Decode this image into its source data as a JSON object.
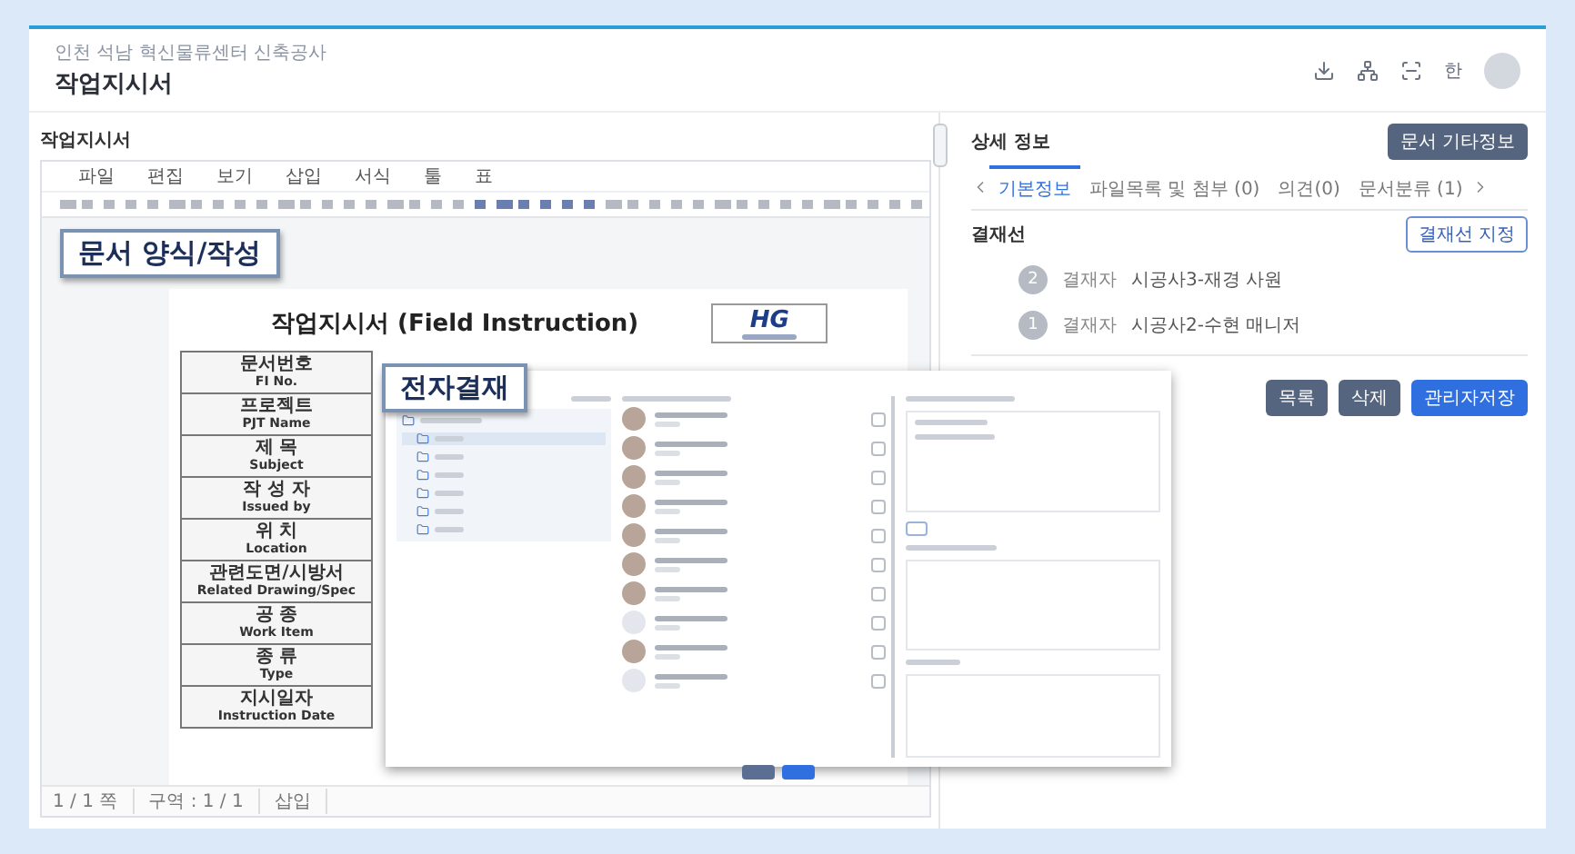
{
  "header": {
    "breadcrumb": "인천 석남 혁신물류센터 신축공사",
    "title": "작업지시서",
    "user_initial": "한"
  },
  "editor": {
    "label": "작업지시서",
    "menu": [
      "파일",
      "편집",
      "보기",
      "삽입",
      "서식",
      "툴",
      "표"
    ],
    "callout": "문서 양식/작성",
    "document": {
      "title": "작업지시서 (Field Instruction)",
      "logo": "HG",
      "fields": [
        {
          "ko": "문서번호",
          "en": "FI No."
        },
        {
          "ko": "프로젝트",
          "en": "PJT Name"
        },
        {
          "ko": "제 목",
          "en": "Subject"
        },
        {
          "ko": "작 성 자",
          "en": "Issued by"
        },
        {
          "ko": "위 치",
          "en": "Location"
        },
        {
          "ko": "관련도면/시방서",
          "en": "Related Drawing/Spec"
        },
        {
          "ko": "공 종",
          "en": "Work Item"
        },
        {
          "ko": "종 류",
          "en": "Type"
        },
        {
          "ko": "지시일자",
          "en": "Instruction Date"
        }
      ]
    },
    "status": [
      "1 / 1 쪽",
      "구역 : 1 / 1",
      "삽입"
    ]
  },
  "detail": {
    "title": "상세 정보",
    "extra_button": "문서 기타정보",
    "tabs": [
      {
        "label": "기본정보",
        "selected": true
      },
      {
        "label": "파일목록 및 첨부 (0)",
        "selected": false
      },
      {
        "label": "의견(0)",
        "selected": false
      },
      {
        "label": "문서분류 (1)",
        "selected": false
      }
    ],
    "approval": {
      "title": "결재선",
      "assign_button": "결재선 지정",
      "steps": [
        {
          "number": "2",
          "role": "결재자",
          "name": "시공사3-재경 사원"
        },
        {
          "number": "1",
          "role": "결재자",
          "name": "시공사2-수현 매니저"
        }
      ]
    },
    "actions": [
      {
        "label": "목록",
        "kind": "secondary"
      },
      {
        "label": "삭제",
        "kind": "secondary"
      },
      {
        "label": "관리자저장",
        "kind": "primary"
      }
    ]
  },
  "dialog": {
    "callout": "전자결재",
    "people": [
      {
        "kind": "photo",
        "checked": false
      },
      {
        "kind": "photo",
        "checked": false
      },
      {
        "kind": "photo",
        "checked": false
      },
      {
        "kind": "photo",
        "checked": false
      },
      {
        "kind": "photo",
        "checked": false
      },
      {
        "kind": "photo",
        "checked": false
      },
      {
        "kind": "photo",
        "checked": false
      },
      {
        "kind": "default",
        "checked": false
      },
      {
        "kind": "photo",
        "checked": false
      },
      {
        "kind": "default",
        "checked": false
      }
    ]
  }
}
